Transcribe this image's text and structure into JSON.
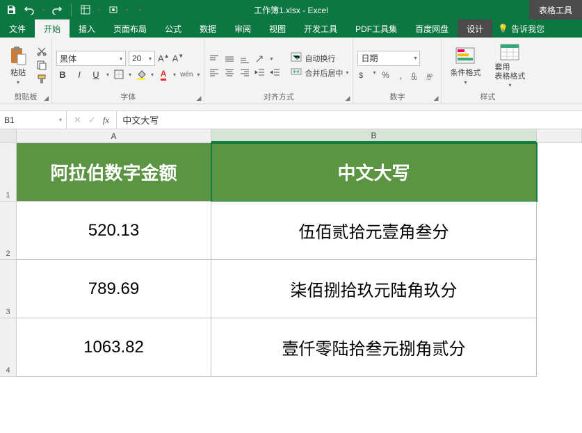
{
  "app": {
    "title": "工作簿1.xlsx - Excel",
    "tool_tab": "表格工具"
  },
  "qat": {
    "save": "save",
    "undo": "undo",
    "redo": "redo"
  },
  "tabs": {
    "file": "文件",
    "home": "开始",
    "insert": "插入",
    "page_layout": "页面布局",
    "formulas": "公式",
    "data": "数据",
    "review": "审阅",
    "view": "视图",
    "developer": "开发工具",
    "pdf": "PDF工具集",
    "baidu": "百度网盘",
    "design": "设计",
    "tell_me": "告诉我您"
  },
  "ribbon": {
    "clipboard": {
      "paste": "粘贴",
      "label": "剪贴板"
    },
    "font": {
      "name": "黑体",
      "size": "20",
      "bold": "B",
      "italic": "I",
      "underline": "U",
      "wen": "wén",
      "label": "字体"
    },
    "alignment": {
      "wrap": "自动换行",
      "merge": "合并后居中",
      "label": "对齐方式"
    },
    "number": {
      "format": "日期",
      "label": "数字"
    },
    "styles": {
      "cond_format": "条件格式",
      "table_format": "套用\n表格格式",
      "label": "样式"
    }
  },
  "namebox": {
    "ref": "B1"
  },
  "formula": {
    "value": "中文大写"
  },
  "columns": {
    "A": "A",
    "B": "B"
  },
  "rows": {
    "r1": "1",
    "r2": "2",
    "r3": "3",
    "r4": "4"
  },
  "sheet": {
    "header": {
      "A": "阿拉伯数字金额",
      "B": "中文大写"
    },
    "rows": [
      {
        "A": "520.13",
        "B": "伍佰贰拾元壹角叁分"
      },
      {
        "A": "789.69",
        "B": "柒佰捌拾玖元陆角玖分"
      },
      {
        "A": "1063.82",
        "B": "壹仟零陆拾叁元捌角贰分"
      }
    ]
  }
}
